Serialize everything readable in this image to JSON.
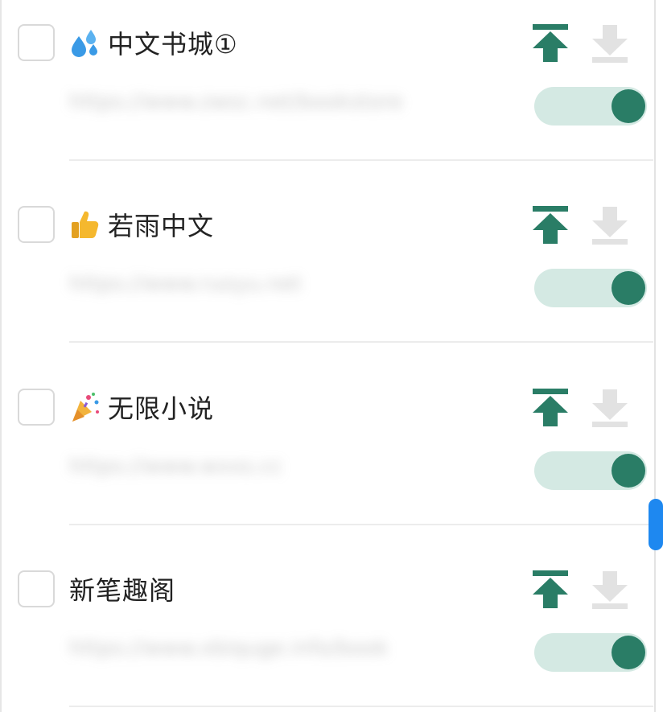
{
  "sources": [
    {
      "title": "中文书城①",
      "url": "https://www.zwsc.net/bookstore",
      "emoji": "sweat-droplets",
      "enabled": true
    },
    {
      "title": "若雨中文",
      "url": "https://www.ruoyu.net",
      "emoji": "thumbs-up",
      "enabled": true
    },
    {
      "title": "无限小说",
      "url": "https://www.wxxs.cc",
      "emoji": "party-popper",
      "enabled": true
    },
    {
      "title": "新笔趣阁",
      "url": "https://www.xbiquge.info/book",
      "emoji": "",
      "enabled": true
    }
  ],
  "icons": {
    "move_top": "move-to-top-icon",
    "move_bottom": "move-to-bottom-icon"
  },
  "colors": {
    "accent": "#2a7d66",
    "toggle_track": "#d4e9e3",
    "disabled_icon": "#e2e2e2",
    "scroll_thumb": "#1e88f0"
  }
}
